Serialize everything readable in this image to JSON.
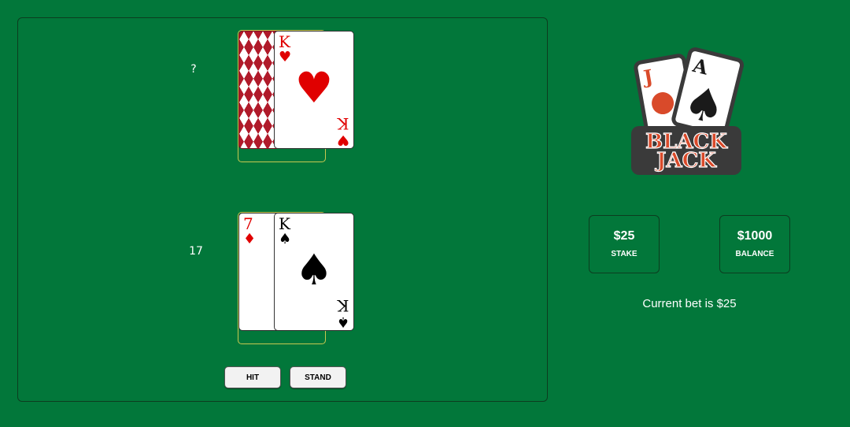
{
  "dealer": {
    "score": "?",
    "cards": [
      {
        "face_down": true
      },
      {
        "rank": "K",
        "suit": "♥",
        "suit_name": "hearts",
        "color": "red"
      }
    ]
  },
  "player": {
    "score": "17",
    "cards": [
      {
        "rank": "7",
        "suit": "♦",
        "suit_name": "diamonds",
        "color": "red"
      },
      {
        "rank": "K",
        "suit": "♠",
        "suit_name": "spades",
        "color": "black"
      }
    ]
  },
  "controls": {
    "hit_label": "HIT",
    "stand_label": "STAND"
  },
  "logo": {
    "line1": "BLACK",
    "line2": "JACK",
    "card1_rank": "J",
    "card2_rank": "A",
    "card2_suit": "♠"
  },
  "stake": {
    "amount": "$25",
    "label": "STAKE"
  },
  "balance": {
    "amount": "$1000",
    "label": "BALANCE"
  },
  "bet_message": "Current bet is $25",
  "colors": {
    "felt": "#02773a",
    "card_back": "#b01a2a",
    "red_suit": "#e00000",
    "slot_border": "#c8c850",
    "logo_red": "#d94a2a"
  }
}
